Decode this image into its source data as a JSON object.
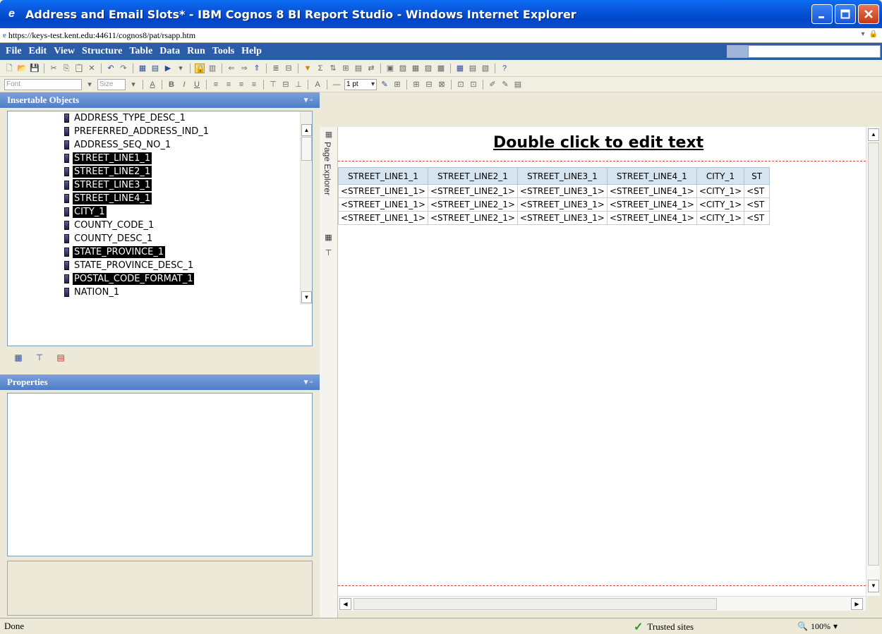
{
  "window": {
    "title": "Address and Email Slots* - IBM Cognos 8 BI Report Studio - Windows Internet Explorer",
    "url": "https://keys-test.kent.edu:44611/cognos8/pat/rsapp.htm"
  },
  "menu": [
    "File",
    "Edit",
    "View",
    "Structure",
    "Table",
    "Data",
    "Run",
    "Tools",
    "Help"
  ],
  "toolbar2": {
    "font_placeholder": "Font",
    "size_placeholder": "Size",
    "line_width": "1 pt"
  },
  "insertable_objects": {
    "title": "Insertable Objects",
    "items": [
      {
        "label": "ADDRESS_TYPE_DESC_1",
        "selected": false
      },
      {
        "label": "PREFERRED_ADDRESS_IND_1",
        "selected": false
      },
      {
        "label": "ADDRESS_SEQ_NO_1",
        "selected": false
      },
      {
        "label": "STREET_LINE1_1",
        "selected": true
      },
      {
        "label": "STREET_LINE2_1",
        "selected": true
      },
      {
        "label": "STREET_LINE3_1",
        "selected": true
      },
      {
        "label": "STREET_LINE4_1",
        "selected": true
      },
      {
        "label": "CITY_1",
        "selected": true
      },
      {
        "label": "COUNTY_CODE_1",
        "selected": false
      },
      {
        "label": "COUNTY_DESC_1",
        "selected": false
      },
      {
        "label": "STATE_PROVINCE_1",
        "selected": true
      },
      {
        "label": "STATE_PROVINCE_DESC_1",
        "selected": false
      },
      {
        "label": "POSTAL_CODE_FORMAT_1",
        "selected": true
      },
      {
        "label": "NATION_1",
        "selected": false
      }
    ]
  },
  "properties": {
    "title": "Properties"
  },
  "page_explorer": {
    "label": "Page Explorer"
  },
  "report": {
    "title": "Double click to edit text",
    "columns": [
      "STREET_LINE1_1",
      "STREET_LINE2_1",
      "STREET_LINE3_1",
      "STREET_LINE4_1",
      "CITY_1",
      "ST"
    ],
    "rows": [
      [
        "<STREET_LINE1_1>",
        "<STREET_LINE2_1>",
        "<STREET_LINE3_1>",
        "<STREET_LINE4_1>",
        "<CITY_1>",
        "<ST"
      ],
      [
        "<STREET_LINE1_1>",
        "<STREET_LINE2_1>",
        "<STREET_LINE3_1>",
        "<STREET_LINE4_1>",
        "<CITY_1>",
        "<ST"
      ],
      [
        "<STREET_LINE1_1>",
        "<STREET_LINE2_1>",
        "<STREET_LINE3_1>",
        "<STREET_LINE4_1>",
        "<CITY_1>",
        "<ST"
      ]
    ]
  },
  "status": {
    "text": "Done",
    "zone": "Trusted sites",
    "zoom": "100%"
  }
}
